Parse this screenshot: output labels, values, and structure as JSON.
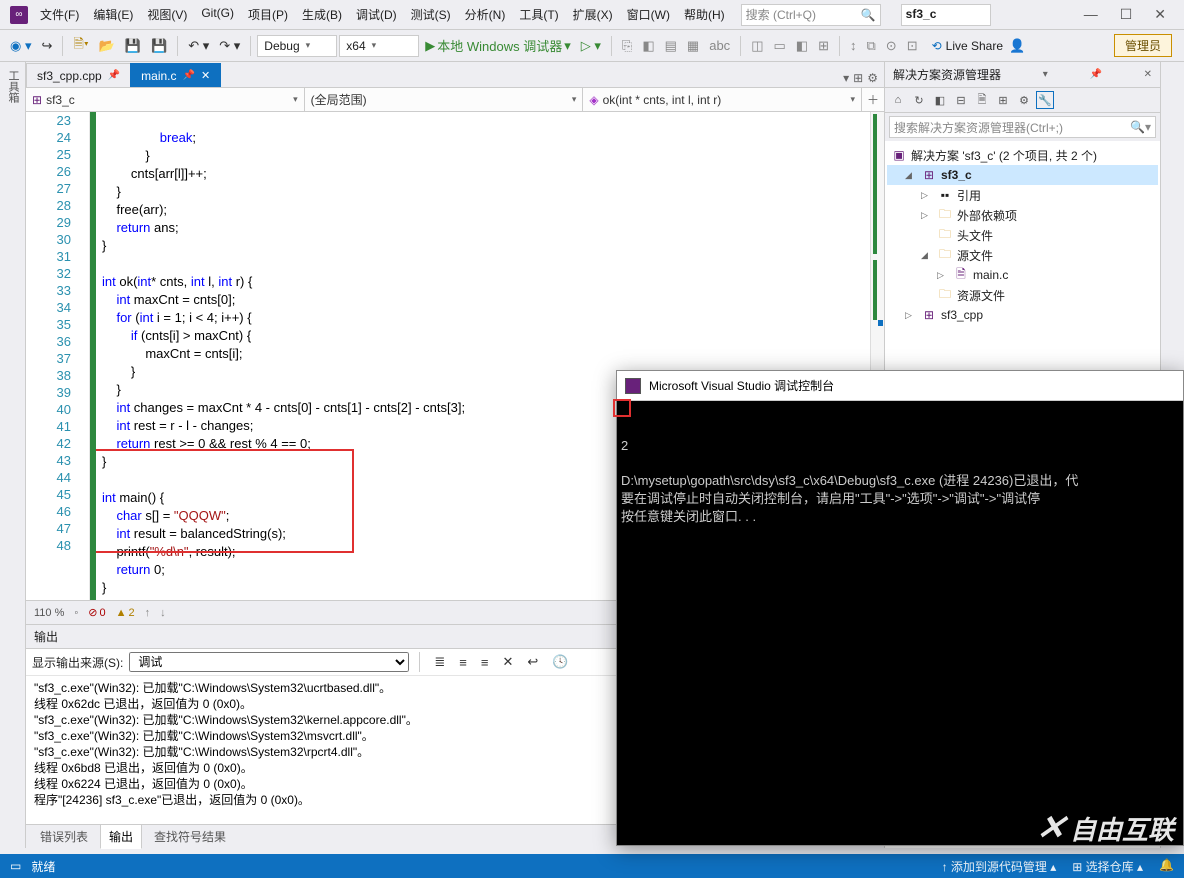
{
  "menu": {
    "file": "文件(F)",
    "edit": "编辑(E)",
    "view": "视图(V)",
    "git": "Git(G)",
    "project": "项目(P)",
    "build": "生成(B)",
    "debug": "调试(D)",
    "test": "测试(S)",
    "analyze": "分析(N)",
    "tools": "工具(T)",
    "extensions": "扩展(X)",
    "window": "窗口(W)",
    "help": "帮助(H)"
  },
  "search": {
    "placeholder": "搜索 (Ctrl+Q)"
  },
  "startup_project": "sf3_c",
  "window_buttons": {
    "min": "—",
    "max": "☐",
    "close": "✕"
  },
  "toolbar": {
    "config": "Debug",
    "platform": "x64",
    "debug_target": "本地 Windows 调试器",
    "liveshare": "Live Share",
    "admin": "管理员"
  },
  "left_collapsed": "工具箱",
  "file_tabs": {
    "inactive": "sf3_cpp.cpp",
    "active": "main.c"
  },
  "nav": {
    "scope": "sf3_c",
    "scope_icon": "⊞",
    "func_scope": "(全局范围)",
    "member": "ok(int * cnts, int l, int r)",
    "member_icon": "◈"
  },
  "line_numbers": [
    23,
    24,
    25,
    26,
    27,
    28,
    29,
    30,
    31,
    32,
    33,
    34,
    35,
    36,
    37,
    38,
    39,
    40,
    41,
    42,
    43,
    44,
    45,
    46,
    47,
    48
  ],
  "code": {
    "l23": "                break;",
    "l24": "            }",
    "l25": "        cnts[arr[l]]++;",
    "l26": "    }",
    "l27": "    free(arr);",
    "l28": "    return ans;",
    "l29": "}",
    "l30": "",
    "l31": "int ok(int* cnts, int l, int r) {",
    "l32": "    int maxCnt = cnts[0];",
    "l33": "    for (int i = 1; i < 4; i++) {",
    "l34": "        if (cnts[i] > maxCnt) {",
    "l35": "            maxCnt = cnts[i];",
    "l36": "        }",
    "l37": "    }",
    "l38": "    int changes = maxCnt * 4 - cnts[0] - cnts[1] - cnts[2] - cnts[3];",
    "l39": "    int rest = r - l - changes;",
    "l40": "    return rest >= 0 && rest % 4 == 0;",
    "l41": "}",
    "l42": "",
    "l43": "int main() {",
    "l44": "    char s[] = \"QQQW\";",
    "l45": "    int result = balancedString(s);",
    "l46": "    printf(\"%d\\n\", result);",
    "l47": "    return 0;",
    "l48": "}"
  },
  "editor_footer": {
    "zoom": "110 %",
    "issues": "◦",
    "err_icon": "⊘",
    "err": "0",
    "warn_icon": "▲",
    "warn": "2"
  },
  "output": {
    "title": "输出",
    "source_label": "显示输出来源(S):",
    "source_value": "调试",
    "lines": [
      "\"sf3_c.exe\"(Win32): 已加载\"C:\\Windows\\System32\\ucrtbased.dll\"。",
      "线程 0x62dc 已退出，返回值为 0 (0x0)。",
      "\"sf3_c.exe\"(Win32): 已加载\"C:\\Windows\\System32\\kernel.appcore.dll\"。",
      "\"sf3_c.exe\"(Win32): 已加载\"C:\\Windows\\System32\\msvcrt.dll\"。",
      "\"sf3_c.exe\"(Win32): 已加载\"C:\\Windows\\System32\\rpcrt4.dll\"。",
      "线程 0x6bd8 已退出，返回值为 0 (0x0)。",
      "线程 0x6224 已退出，返回值为 0 (0x0)。",
      "程序\"[24236] sf3_c.exe\"已退出，返回值为 0 (0x0)。"
    ]
  },
  "bottom_tabs": {
    "errors": "错误列表",
    "output": "输出",
    "symbols": "查找符号结果"
  },
  "solution": {
    "title": "解决方案资源管理器",
    "search_placeholder": "搜索解决方案资源管理器(Ctrl+;)",
    "root": "解决方案 'sf3_c' (2 个项目, 共 2 个)",
    "proj1": "sf3_c",
    "refs": "引用",
    "external": "外部依赖项",
    "headers": "头文件",
    "sources": "源文件",
    "mainc": "main.c",
    "resources": "资源文件",
    "proj2": "sf3_cpp"
  },
  "statusbar": {
    "ready": "就绪",
    "add_src": "↑ 添加到源代码管理 ▴",
    "select_repo": "⊞ 选择仓库 ▴"
  },
  "console": {
    "title": "Microsoft Visual Studio 调试控制台",
    "out": "2",
    "msg": "D:\\mysetup\\gopath\\src\\dsy\\sf3_c\\x64\\Debug\\sf3_c.exe (进程 24236)已退出，代\n要在调试停止时自动关闭控制台，请启用\"工具\"->\"选项\"->\"调试\"->\"调试停\n按任意键关闭此窗口. . ."
  },
  "watermark": "自由互联"
}
